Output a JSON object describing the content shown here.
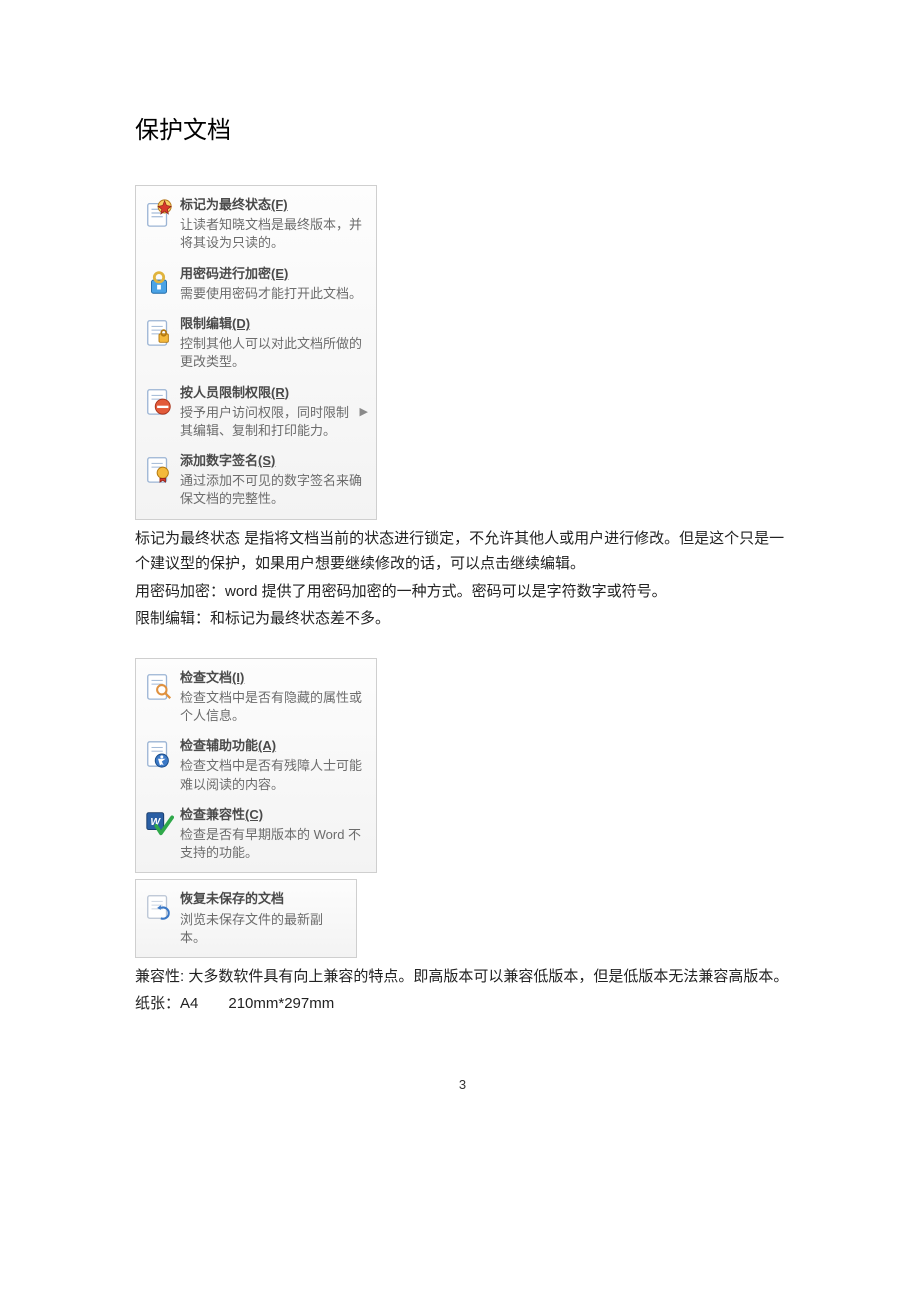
{
  "title": "保护文档",
  "protect_panel": [
    {
      "key": "mark-final",
      "title": "标记为最终状态",
      "hotkey": "(F)",
      "desc": "让读者知晓文档是最终版本，并将其设为只读的。",
      "has_arrow": false
    },
    {
      "key": "encrypt",
      "title": "用密码进行加密",
      "hotkey": "(E)",
      "desc": "需要使用密码才能打开此文档。",
      "has_arrow": false
    },
    {
      "key": "restrict-edit",
      "title": "限制编辑",
      "hotkey": "(D)",
      "desc": "控制其他人可以对此文档所做的更改类型。",
      "has_arrow": false
    },
    {
      "key": "restrict-permission",
      "title": "按人员限制权限",
      "hotkey": "(R)",
      "desc": "授予用户访问权限，同时限制其编辑、复制和打印能力。",
      "has_arrow": true
    },
    {
      "key": "digital-sign",
      "title": "添加数字签名",
      "hotkey": "(S)",
      "desc": "通过添加不可见的数字签名来确保文档的完整性。",
      "has_arrow": false
    }
  ],
  "para1": "标记为最终状态 是指将文档当前的状态进行锁定，不允许其他人或用户进行修改。但是这个只是一个建议型的保护，如果用户想要继续修改的话，可以点击继续编辑。",
  "para2": "用密码加密：word 提供了用密码加密的一种方式。密码可以是字符数字或符号。",
  "para3": "限制编辑：和标记为最终状态差不多。",
  "check_panel": [
    {
      "key": "inspect-doc",
      "title": "检查文档",
      "hotkey": "(I)",
      "desc": "检查文档中是否有隐藏的属性或个人信息。"
    },
    {
      "key": "accessibility",
      "title": "检查辅助功能",
      "hotkey": "(A)",
      "desc": "检查文档中是否有残障人士可能难以阅读的内容。"
    },
    {
      "key": "compatibility",
      "title": "检查兼容性",
      "hotkey": "(C)",
      "desc": "检查是否有早期版本的 Word 不支持的功能。"
    }
  ],
  "recover_panel": {
    "key": "recover",
    "title": "恢复未保存的文档",
    "desc": "浏览未保存文件的最新副本。"
  },
  "para4": "兼容性: 大多数软件具有向上兼容的特点。即高版本可以兼容低版本，但是低版本无法兼容高版本。",
  "para5": "纸张：A4  210mm*297mm",
  "page_number": "3"
}
